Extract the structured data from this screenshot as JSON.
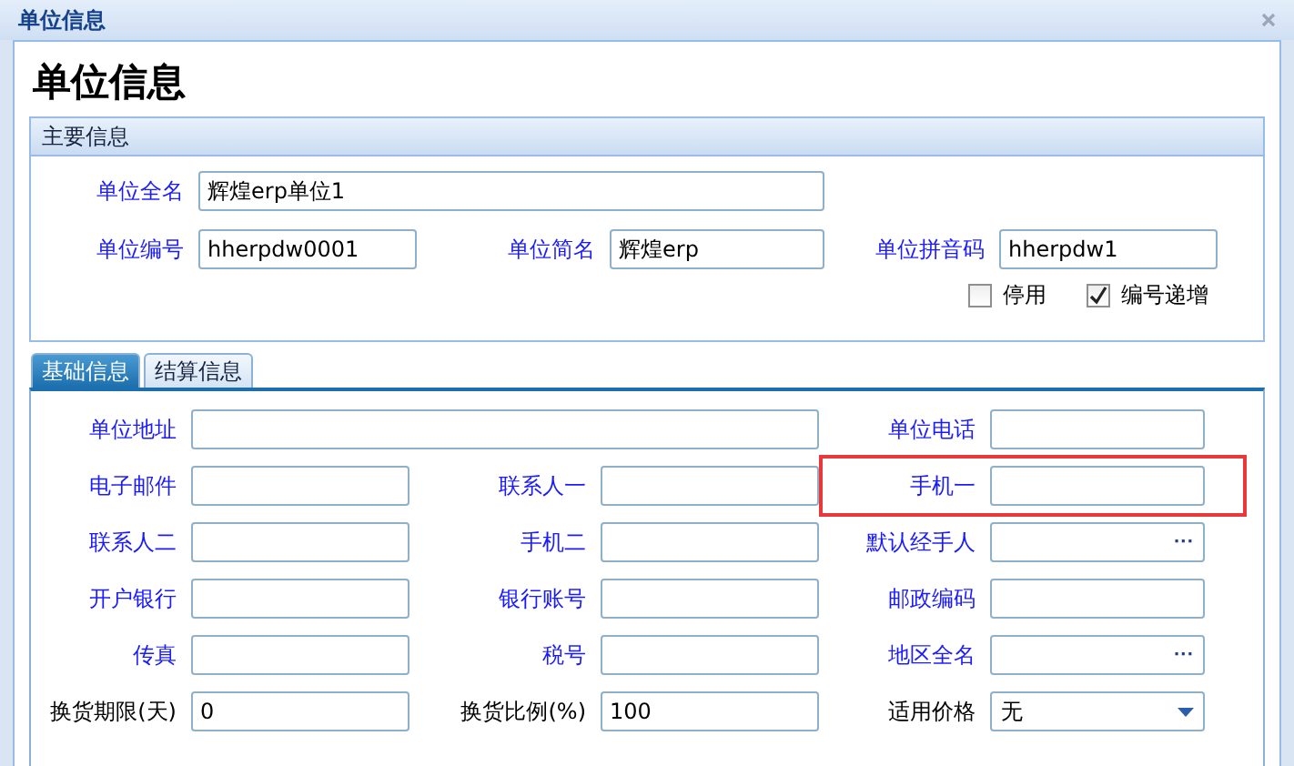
{
  "window": {
    "title": "单位信息"
  },
  "heading": "单位信息",
  "main_section": {
    "title": "主要信息",
    "rows": [
      [
        {
          "label": "单位全名",
          "value": "辉煌erp单位1",
          "kind": "wide"
        }
      ],
      [
        {
          "label": "单位编号",
          "value": "hherpdw0001",
          "kind": "text"
        },
        {
          "label": "单位简名",
          "value": "辉煌erp",
          "kind": "text"
        },
        {
          "label": "单位拼音码",
          "value": "hherpdw1",
          "kind": "text"
        }
      ]
    ],
    "checkboxes": [
      {
        "label": "停用",
        "checked": false
      },
      {
        "label": "编号递增",
        "checked": true
      }
    ]
  },
  "tabs": [
    {
      "label": "基础信息",
      "selected": true
    },
    {
      "label": "结算信息",
      "selected": false
    }
  ],
  "fields": [
    [
      {
        "label": "单位地址",
        "kind": "wide",
        "color": "#1a1aff",
        "highlighted": false
      },
      {
        "label": "单位电话",
        "kind": "text",
        "color": "#1a1aff",
        "highlighted": false
      }
    ],
    [
      {
        "label": "电子邮件",
        "kind": "text",
        "color": "#1a1aff",
        "highlighted": false
      },
      {
        "label": "联系人一",
        "kind": "text",
        "color": "#1a1aff",
        "highlighted": false
      },
      {
        "label": "手机一",
        "kind": "text",
        "color": "#1a1aff",
        "highlighted": true
      }
    ],
    [
      {
        "label": "联系人二",
        "kind": "text",
        "color": "#1a1aff",
        "highlighted": false
      },
      {
        "label": "手机二",
        "kind": "text",
        "color": "#1a1aff",
        "highlighted": false
      },
      {
        "label": "默认经手人",
        "kind": "lookup",
        "button": "···",
        "color": "#1a1aff",
        "highlighted": false
      }
    ],
    [
      {
        "label": "开户银行",
        "kind": "text",
        "color": "#1a1aff",
        "highlighted": false
      },
      {
        "label": "银行账号",
        "kind": "text",
        "color": "#1a1aff",
        "highlighted": false
      },
      {
        "label": "邮政编码",
        "kind": "text",
        "color": "#1a1aff",
        "highlighted": false
      }
    ],
    [
      {
        "label": "传真",
        "kind": "text",
        "color": "#1a1aff",
        "highlighted": false
      },
      {
        "label": "税号",
        "kind": "text",
        "color": "#1a1aff",
        "highlighted": false
      },
      {
        "label": "地区全名",
        "kind": "lookup",
        "button": "···",
        "color": "#1a1aff",
        "highlighted": false
      }
    ],
    [
      {
        "label": "换货期限(天)",
        "kind": "text",
        "value": "0",
        "color": "#000000",
        "highlighted": false
      },
      {
        "label": "换货比例(%)",
        "kind": "text",
        "value": "100",
        "color": "#000000",
        "highlighted": false
      },
      {
        "label": "适用价格",
        "kind": "select",
        "value": "无",
        "color": "#000000",
        "highlighted": false
      }
    ]
  ]
}
